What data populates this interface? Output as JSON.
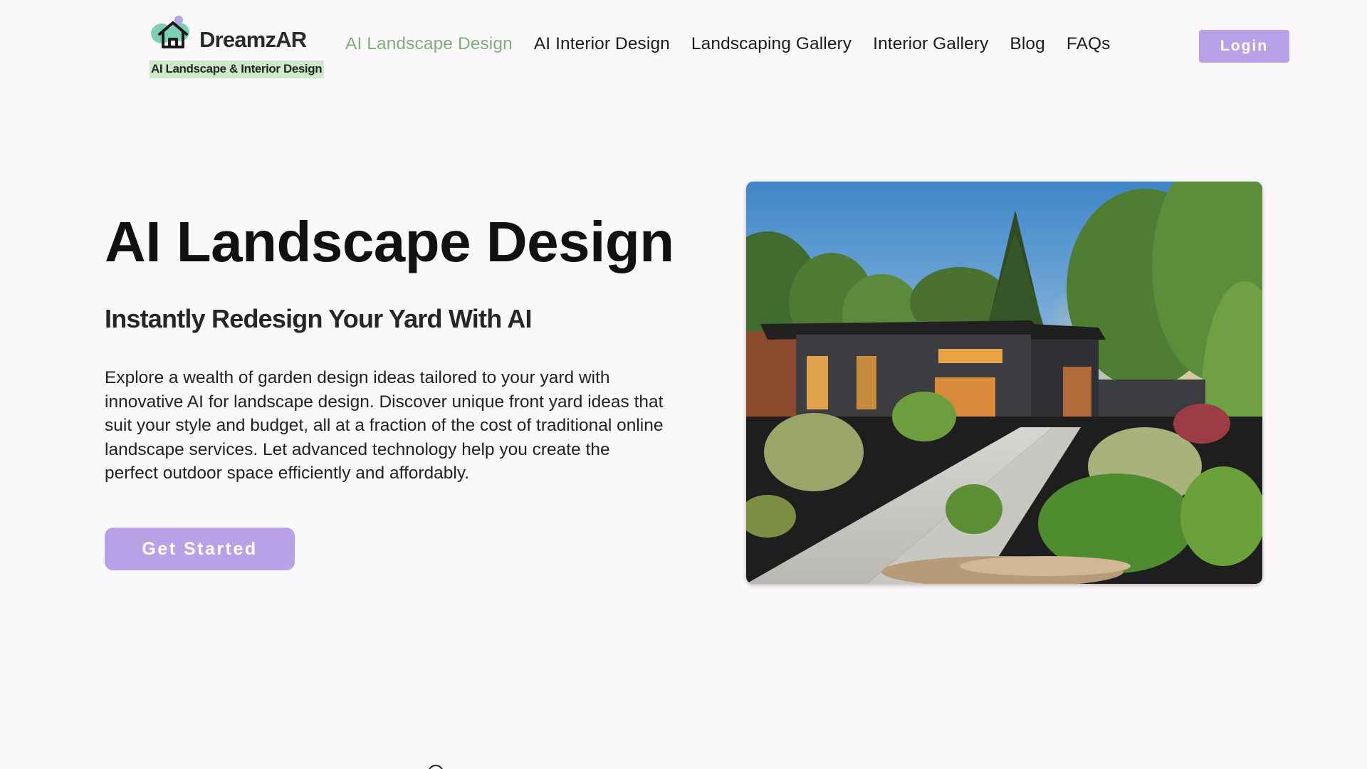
{
  "header": {
    "logo_name": "DreamzAR",
    "logo_tagline": "AI Landscape & Interior Design",
    "nav": [
      {
        "label": "AI Landscape Design",
        "active": true
      },
      {
        "label": "AI Interior Design",
        "active": false
      },
      {
        "label": "Landscaping Gallery",
        "active": false
      },
      {
        "label": "Interior Gallery",
        "active": false
      },
      {
        "label": "Blog",
        "active": false
      },
      {
        "label": "FAQs",
        "active": false
      }
    ],
    "login_label": "Login"
  },
  "hero": {
    "title": "AI Landscape Design",
    "subtitle": "Instantly Redesign Your Yard With AI",
    "body": "Explore a wealth of garden design ideas tailored to your yard with innovative AI for landscape design. Discover unique front yard ideas that suit your style and budget, all at a fraction of the cost of traditional online landscape services. Let advanced technology help you create the perfect outdoor space efficiently and affordably.",
    "cta_label": "Get Started",
    "image_subject": "modern-house-landscaped-front-yard"
  },
  "colors": {
    "background": "#fbf8fc",
    "accent_purple": "#b8a1e6",
    "active_nav_green": "#7fae79",
    "tagline_highlight": "#cfe8cc",
    "logo_teal": "#7ccfb5"
  }
}
